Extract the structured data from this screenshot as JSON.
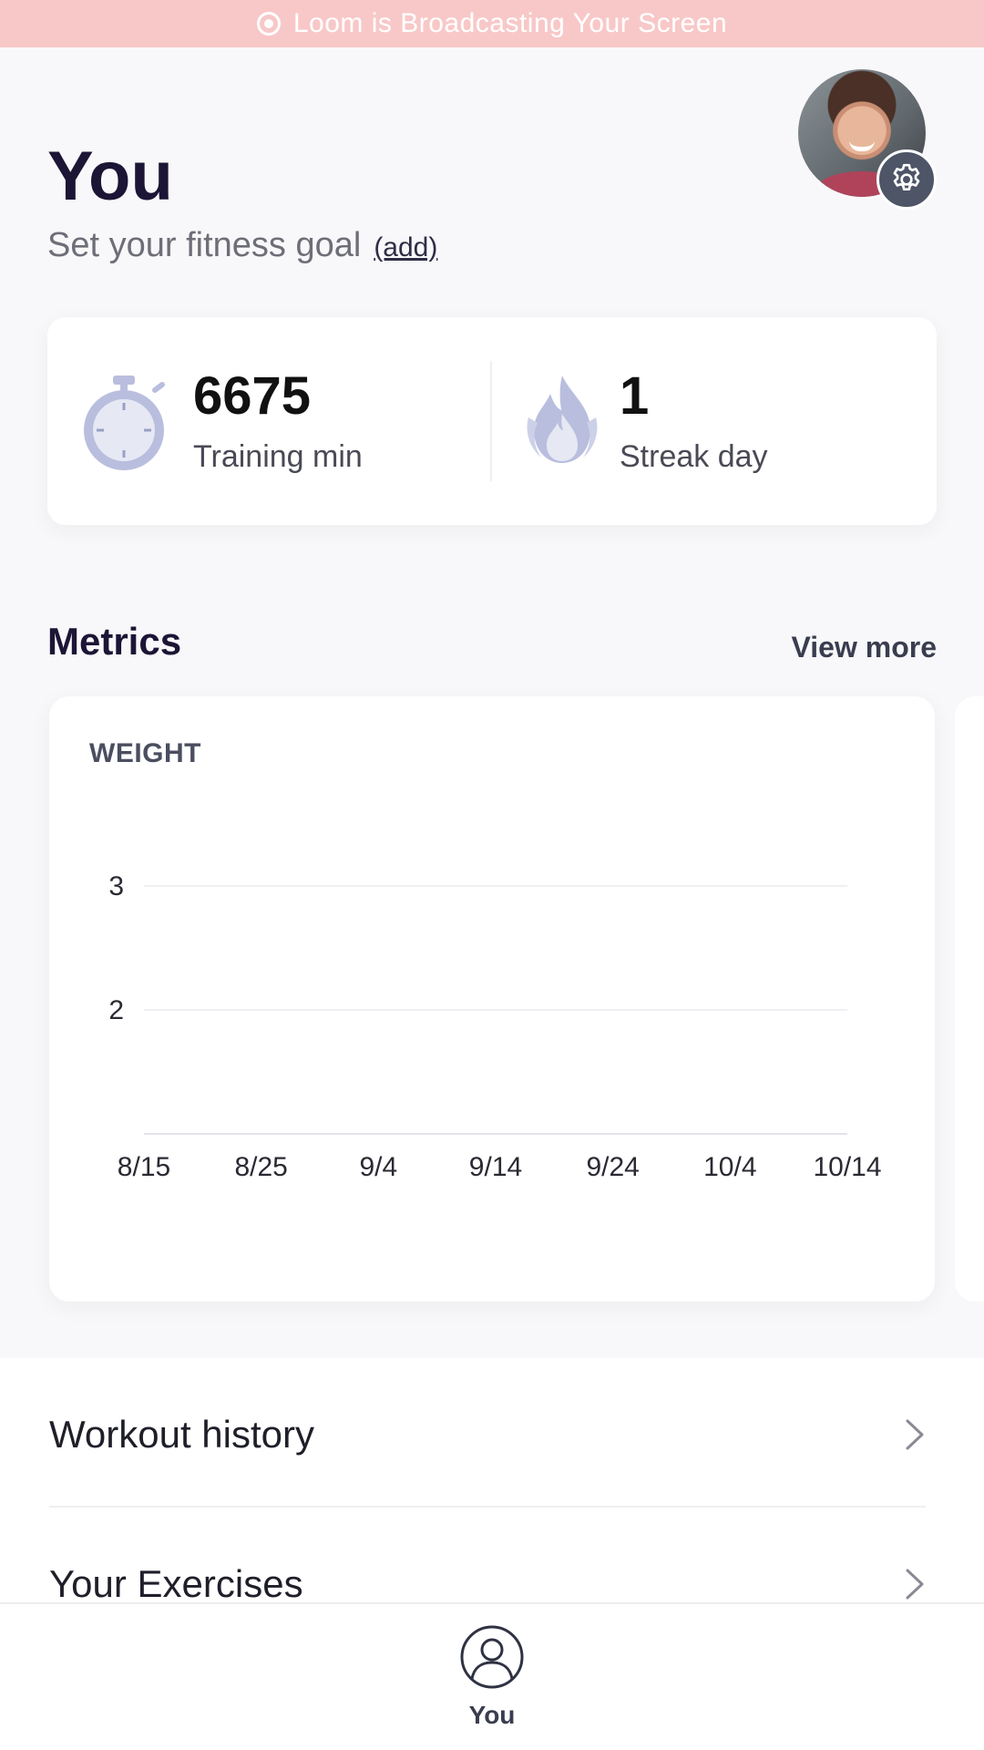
{
  "banner": {
    "text": "Loom is Broadcasting Your Screen"
  },
  "header": {
    "title": "You",
    "goal_text": "Set your fitness goal",
    "goal_link": "(add)"
  },
  "stats": [
    {
      "value": "6675",
      "label": "Training min",
      "icon": "stopwatch-icon"
    },
    {
      "value": "1",
      "label": "Streak day",
      "icon": "flame-icon"
    }
  ],
  "metrics": {
    "title": "Metrics",
    "view_more": "View more"
  },
  "chart_data": {
    "type": "line",
    "title": "WEIGHT",
    "xlabel": "",
    "ylabel": "",
    "x_ticks": [
      "8/15",
      "8/25",
      "9/4",
      "9/14",
      "9/24",
      "10/4",
      "10/14"
    ],
    "y_ticks": [
      2,
      3
    ],
    "ylim": [
      1,
      3
    ],
    "grid": true,
    "series": []
  },
  "list": {
    "items": [
      {
        "label": "Workout history"
      },
      {
        "label": "Your Exercises"
      }
    ]
  },
  "tabbar": {
    "tabs": [
      {
        "label": "You",
        "icon": "user-icon"
      }
    ]
  },
  "colors": {
    "accent": "#1c1535",
    "banner": "#f8c8c8",
    "icon_tint": "#b9bede"
  }
}
